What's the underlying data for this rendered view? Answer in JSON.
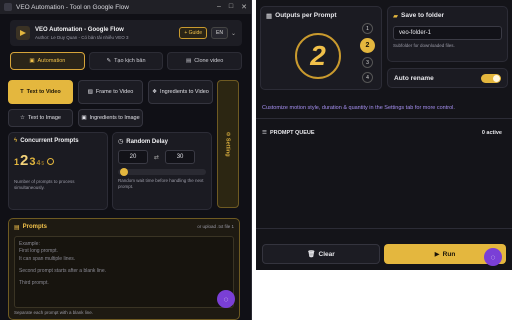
{
  "window": {
    "title": "VEO Automation - Tool on Google Flow"
  },
  "header": {
    "title": "VEO Automation - Google Flow",
    "subtitle": "Author: Le Duy Quan - Có bản tải nhiều VEO 3",
    "guide_label": "+ Guide",
    "lang_label": "EN",
    "lang_icon": "chevron-down-icon"
  },
  "tabs": [
    {
      "label": "Automation",
      "active": true
    },
    {
      "label": "Tạo kịch bản",
      "active": false
    },
    {
      "label": "Clone video",
      "active": false
    }
  ],
  "modes": [
    {
      "label": "Text to Video",
      "active": true
    },
    {
      "label": "Frame to Video",
      "active": false
    },
    {
      "label": "Ingredients to Video",
      "active": false
    },
    {
      "label": "Text to Image",
      "active": false
    },
    {
      "label": "Ingredients to Image",
      "active": false
    }
  ],
  "settings_strip": {
    "label": "Setting"
  },
  "concurrent": {
    "title": "Concurrent Prompts",
    "digits": [
      "1",
      "2",
      "3",
      "4",
      "5"
    ],
    "desc": "Number of prompts to process simultaneously."
  },
  "delay": {
    "title": "Random Delay",
    "min": "20",
    "max": "30",
    "swap": "⇄",
    "desc": "Random wait time before handling the next prompt."
  },
  "prompts": {
    "title": "Prompts",
    "hint": "or upload .txt file 1",
    "placeholder_lines": [
      "Example:",
      "First long prompt.",
      "It can span multiple lines.",
      "",
      "Second prompt starts after a blank line.",
      "",
      "Third prompt."
    ],
    "footer": "Separate each prompt with a blank line."
  },
  "outputs": {
    "title": "Outputs per Prompt",
    "big_number": "2",
    "options": [
      "1",
      "2",
      "3",
      "4"
    ],
    "selected": "2"
  },
  "folder": {
    "title": "Save to folder",
    "value": "veo-folder-1",
    "desc": "Subfolder for downloaded files."
  },
  "auto_rename": {
    "label": "Auto rename",
    "on": true
  },
  "tip": "Customize motion style, duration & quantity in the Settings tab for more control.",
  "queue": {
    "title": "PROMPT QUEUE",
    "count": "0 active"
  },
  "buttons": {
    "clear": "Clear",
    "run": "Run"
  },
  "colors": {
    "accent": "#e4b73e",
    "fab": "#7a3fd6",
    "tip": "#a58ff0"
  }
}
